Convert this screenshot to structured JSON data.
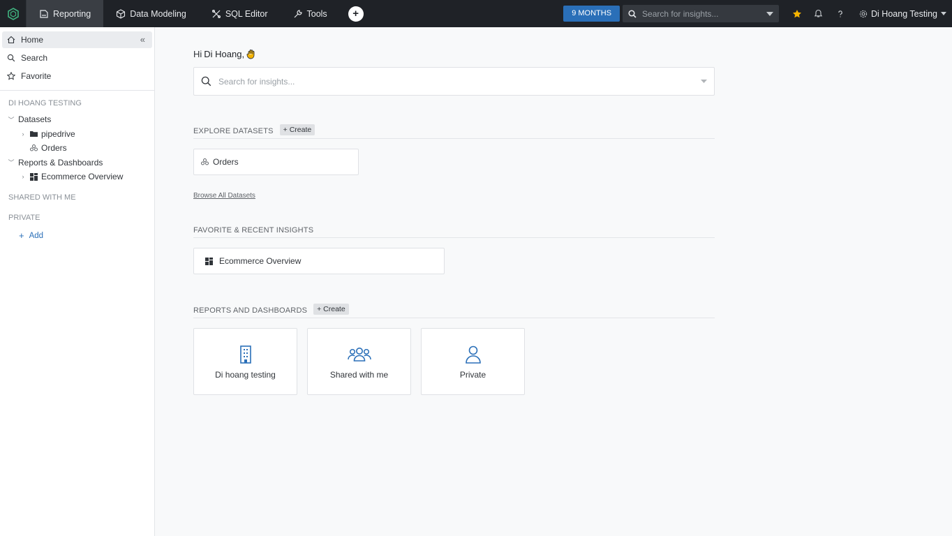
{
  "nav": {
    "items": [
      {
        "label": "Reporting",
        "icon": "reporting-icon"
      },
      {
        "label": "Data Modeling",
        "icon": "cube-icon"
      },
      {
        "label": "SQL Editor",
        "icon": "sql-editor-icon"
      },
      {
        "label": "Tools",
        "icon": "wrench-icon"
      }
    ],
    "date_range": "9 MONTHS",
    "search_placeholder": "Search for insights...",
    "user_name": "Di Hoang Testing"
  },
  "sidebar": {
    "links": [
      {
        "label": "Home",
        "icon": "home-icon"
      },
      {
        "label": "Search",
        "icon": "search-icon"
      },
      {
        "label": "Favorite",
        "icon": "star-icon"
      }
    ],
    "workspace_title": "DI HOANG TESTING",
    "tree": {
      "datasets": "Datasets",
      "pipedrive": "pipedrive",
      "orders": "Orders",
      "reports": "Reports & Dashboards",
      "ecommerce": "Ecommerce Overview"
    },
    "shared_title": "SHARED WITH ME",
    "private_title": "PRIVATE",
    "add_label": "Add"
  },
  "main": {
    "greeting_prefix": "Hi",
    "greeting_name": "Di Hoang,",
    "search_placeholder": "Search for insights...",
    "explore_title": "EXPLORE DATASETS",
    "create_label": "+ Create",
    "dataset_card": "Orders",
    "browse_link": "Browse All Datasets",
    "favorite_title": "FAVORITE & RECENT INSIGHTS",
    "favorite_card": "Ecommerce Overview",
    "reports_title": "REPORTS AND DASHBOARDS",
    "tiles": [
      {
        "label": "Di hoang testing",
        "icon": "building-icon"
      },
      {
        "label": "Shared with me",
        "icon": "users-group-icon"
      },
      {
        "label": "Private",
        "icon": "user-icon"
      }
    ]
  },
  "colors": {
    "topbar": "#1f2227",
    "accent": "#2a6fb8",
    "star": "#f5b400"
  }
}
